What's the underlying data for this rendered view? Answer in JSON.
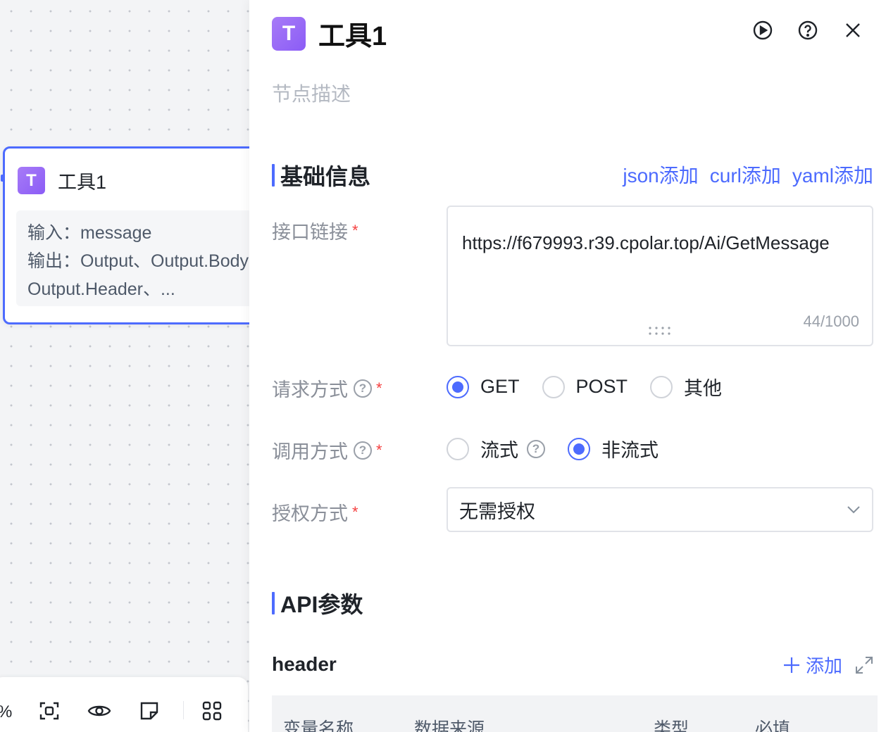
{
  "canvas": {
    "node": {
      "icon": "tool-icon",
      "icon_glyph": "T",
      "title": "工具1",
      "input_line": "输入：message",
      "output_line": "输出：Output、Output.Body、",
      "output_line2": "Output.Header、..."
    },
    "toolbar": {
      "zoom": "%",
      "icons": [
        "fit-view-icon",
        "eye-icon",
        "note-icon",
        "grid-icon"
      ]
    }
  },
  "panel": {
    "icon_glyph": "T",
    "title": "工具1",
    "description_placeholder": "节点描述",
    "actions": [
      "run-icon",
      "help-icon",
      "close-icon"
    ],
    "basic_section": {
      "title": "基础信息",
      "links": [
        "json添加",
        "curl添加",
        "yaml添加"
      ]
    },
    "url_field": {
      "label": "接口链接",
      "required": "*",
      "value": "https://f679993.r39.cpolar.top/Ai/GetMessage",
      "count": "44/1000"
    },
    "method_field": {
      "label": "请求方式",
      "required": "*",
      "help": "?",
      "options": [
        "GET",
        "POST",
        "其他"
      ],
      "selected": "GET"
    },
    "call_field": {
      "label": "调用方式",
      "required": "*",
      "help": "?",
      "options": [
        "流式",
        "非流式"
      ],
      "selected": "非流式"
    },
    "auth_field": {
      "label": "授权方式",
      "required": "*",
      "value": "无需授权"
    },
    "api_section": {
      "title": "API参数"
    },
    "header_group": {
      "title": "header",
      "add_label": "添加",
      "columns": [
        "变量名称",
        "数据来源",
        "类型",
        "必填"
      ]
    }
  },
  "colors": {
    "accent": "#4d6bfe",
    "tool_icon": "#8b5cf6",
    "required": "#f53f3f"
  }
}
